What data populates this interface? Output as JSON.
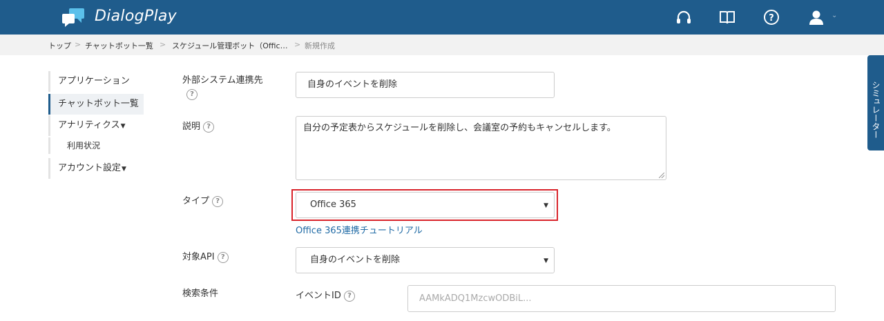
{
  "header": {
    "brand": "DialogPlay",
    "icons": [
      "headset-icon",
      "book-icon",
      "help-icon",
      "user-icon"
    ]
  },
  "breadcrumb": {
    "items": [
      "トップ",
      "チャットボット一覧",
      "スケジュール管理ボット（Offic…",
      "新規作成"
    ],
    "separator": ">"
  },
  "sidebar": {
    "items": [
      {
        "label": "アプリケーション"
      },
      {
        "label": "チャットボット一覧"
      },
      {
        "label": "アナリティクス"
      },
      {
        "label": "利用状況"
      },
      {
        "label": "アカウント設定"
      }
    ]
  },
  "form": {
    "external_system": {
      "label": "外部システム連携先",
      "value": "自身のイベントを削除"
    },
    "description": {
      "label": "説明",
      "value": "自分の予定表からスケジュールを削除し、会議室の予約もキャンセルします。"
    },
    "type": {
      "label": "タイプ",
      "value": "Office 365",
      "tutorial_link": "Office 365連携チュートリアル"
    },
    "target_api": {
      "label": "対象API",
      "value": "自身のイベントを削除"
    },
    "search": {
      "label": "検索条件",
      "event_id_label": "イベントID",
      "event_id_placeholder": "AAMkADQ1MzcwODBiL..."
    }
  },
  "simulator": {
    "label": "シミュレーター"
  },
  "colors": {
    "header": "#1f5c8c",
    "highlight": "#d9232a",
    "link": "#1f6aa5"
  }
}
